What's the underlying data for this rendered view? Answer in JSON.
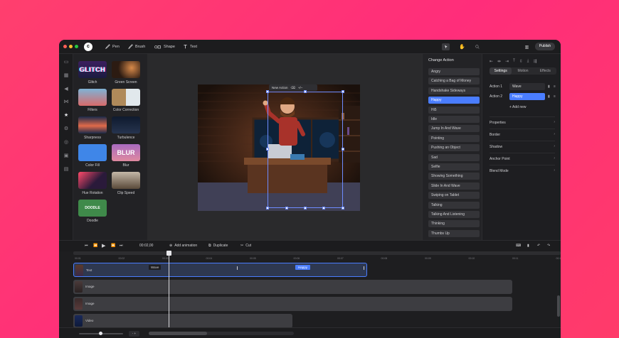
{
  "toolbar": {
    "tools": [
      "Pen",
      "Brush",
      "Shape",
      "Text"
    ],
    "publish_label": "Publish"
  },
  "effects": {
    "items": [
      {
        "label": "Glitch",
        "thumb_text": "GLITCH"
      },
      {
        "label": "Green Screen",
        "thumb_text": ""
      },
      {
        "label": "Filters",
        "thumb_text": ""
      },
      {
        "label": "Color Correction",
        "thumb_text": ""
      },
      {
        "label": "Sharpness",
        "thumb_text": ""
      },
      {
        "label": "Turbulence",
        "thumb_text": ""
      },
      {
        "label": "Color Fill",
        "thumb_text": ""
      },
      {
        "label": "Blur",
        "thumb_text": "BLUR"
      },
      {
        "label": "Hue Rotation",
        "thumb_text": ""
      },
      {
        "label": "Clip Speed",
        "thumb_text": ""
      },
      {
        "label": "Doodle",
        "thumb_text": "DOODLE"
      }
    ]
  },
  "canvas": {
    "action_bar": {
      "label": "New Action",
      "button1": "⌫",
      "button2": "+/−"
    }
  },
  "change_action": {
    "title": "Change Action",
    "items": [
      "Angry",
      "Catching a Bag of Money",
      "Handshake Sideways",
      "Happy",
      "Hi5",
      "Idle",
      "Jump In And Wave",
      "Pointing",
      "Pushing an Object",
      "Sad",
      "Selfie",
      "Showing Something",
      "Slide In And Wave",
      "Swiping on Tablet",
      "Talking",
      "Talking And Listening",
      "Thinking",
      "Thumbs Up"
    ],
    "selected": "Happy"
  },
  "properties": {
    "tabs": [
      "Settings",
      "Motion",
      "Effects"
    ],
    "active_tab": "Settings",
    "actions": [
      {
        "label": "Action 1",
        "value": "Wave"
      },
      {
        "label": "Action 2",
        "value": "Happy"
      }
    ],
    "add_new_label": "+ Add new",
    "sections": [
      "Properties",
      "Border",
      "Shadow",
      "Anchor Point",
      "Blend Mode"
    ]
  },
  "timeline": {
    "time": "00:02,00",
    "add_animation_label": "Add animation",
    "duplicate_label": "Duplicate",
    "cut_label": "Cut",
    "ticks": [
      "00:01",
      "00:02",
      "00:03",
      "00:04",
      "00:05",
      "00:06",
      "00:07",
      "00:08",
      "00:09",
      "00:10",
      "00:11",
      "00:12",
      "00:13",
      "00:14",
      "00:15",
      "00:16"
    ],
    "tracks": [
      {
        "name": "Text",
        "markers": [
          "Wave",
          "Happy"
        ]
      },
      {
        "name": "Image"
      },
      {
        "name": "Image"
      },
      {
        "name": "Video"
      }
    ],
    "zoom_step": "- +"
  },
  "colors": {
    "accent": "#4a7dff",
    "background": "#ff3f6e"
  }
}
